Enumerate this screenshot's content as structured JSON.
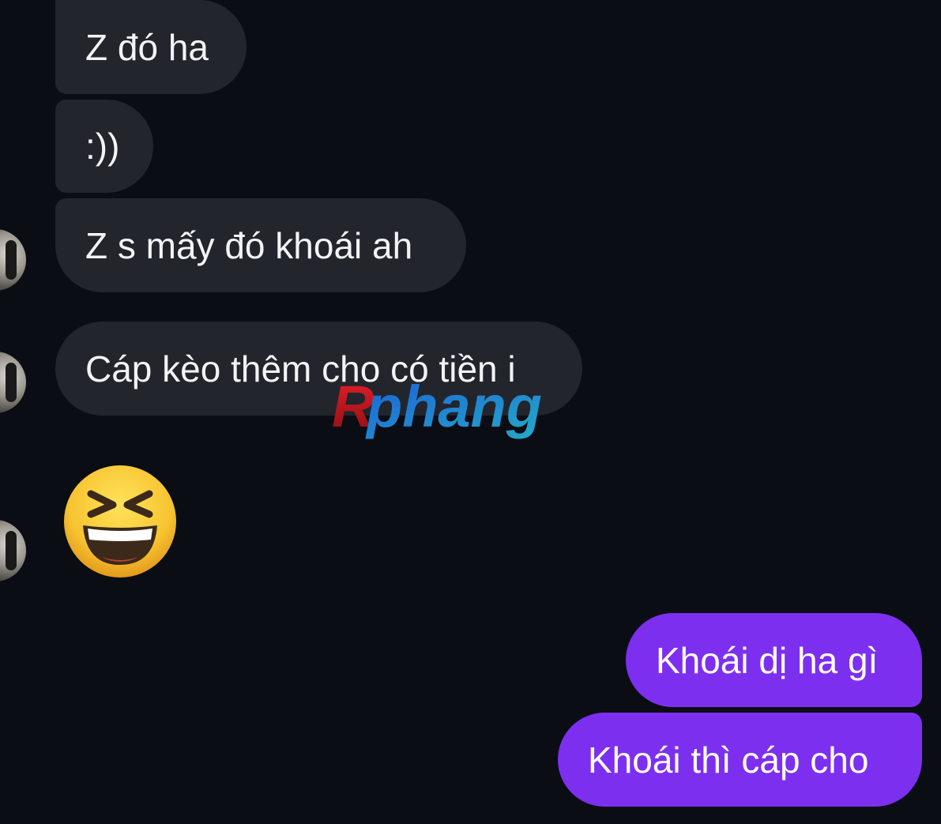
{
  "messages": {
    "incoming": [
      {
        "text": "Z đó ha"
      },
      {
        "text": ":))"
      },
      {
        "text": "Z s mấy đó khoái ah"
      },
      {
        "text": "Cáp kèo thêm cho có tiền i"
      }
    ],
    "emoji": {
      "icon": "grinning-squinting-face-icon",
      "glyph": "😆"
    },
    "outgoing": [
      {
        "text": "Khoái dị ha gì"
      },
      {
        "text": "Khoái thì cáp cho"
      }
    ]
  },
  "watermark": {
    "text": "Rphang"
  },
  "colors": {
    "background": "#0b0d14",
    "incoming_bubble": "#23252c",
    "outgoing_bubble": "#7d2ff0",
    "text": "#f2f3f5"
  }
}
